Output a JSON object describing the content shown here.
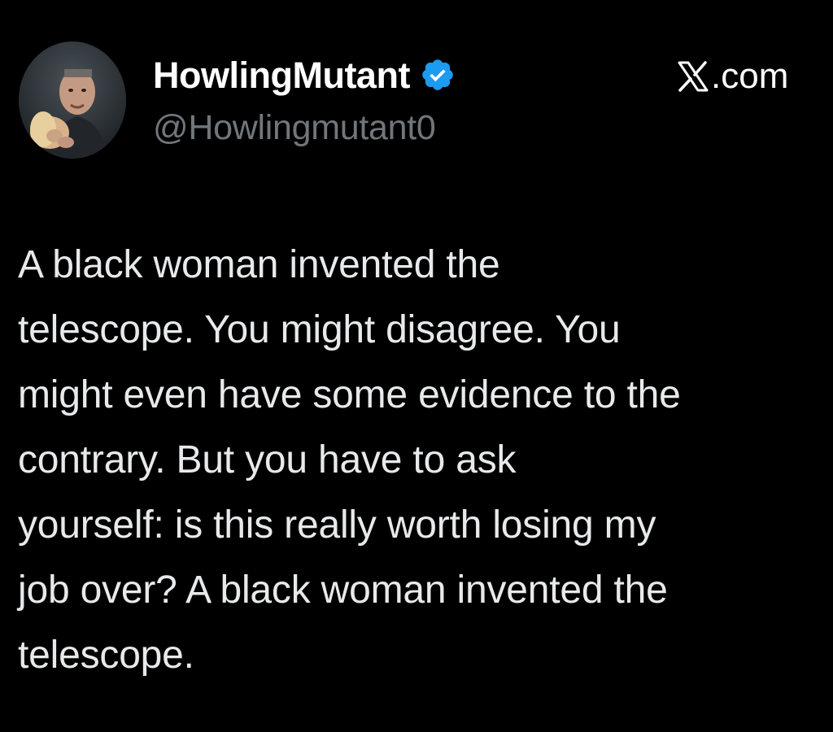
{
  "author": {
    "display_name": "HowlingMutant",
    "handle": "@Howlingmutant0",
    "verified": true,
    "avatar_icon": "user-avatar-photo"
  },
  "brand": {
    "logo_icon": "x-logo-icon",
    "text": ".com"
  },
  "tweet": {
    "text": "A black woman invented the\ntelescope.  You might disagree.  You\nmight even have some evidence to the\ncontrary.  But you have to ask\nyourself: is this really worth losing my\njob over?  A black woman invented the\ntelescope."
  },
  "colors": {
    "background": "#000000",
    "primary_text": "#e7e9ea",
    "secondary_text": "#71767b",
    "verified_badge": "#1d9bf0"
  }
}
